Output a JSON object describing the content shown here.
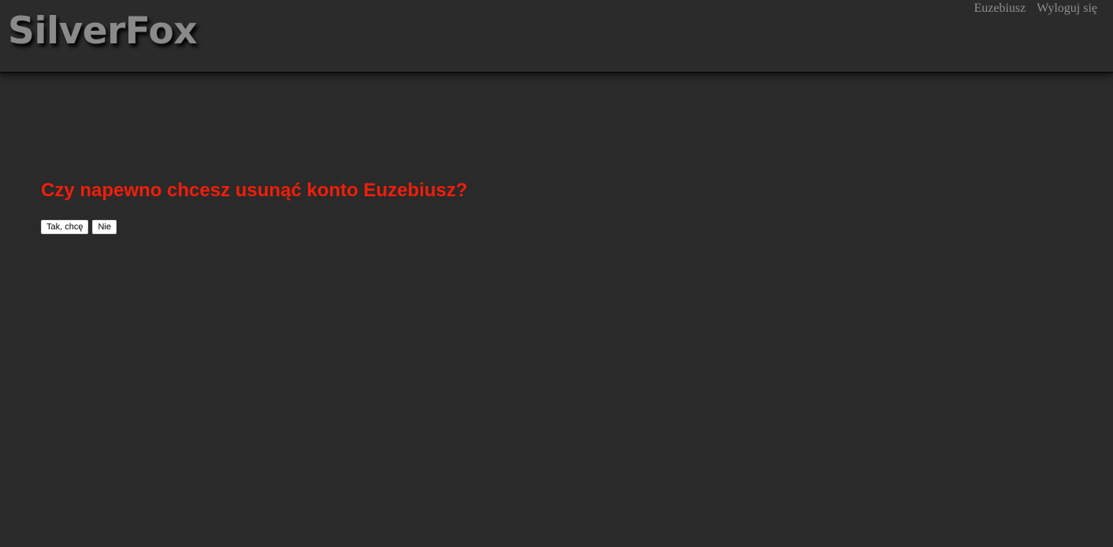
{
  "header": {
    "logo": "SilverFox",
    "user_name": "Euzebiusz",
    "logout_label": "Wyloguj się"
  },
  "main": {
    "confirm_question": "Czy napewno chcesz usunąć konto Euzebiusz?",
    "yes_label": "Tak, chcę",
    "no_label": "Nie"
  },
  "colors": {
    "background": "#2a2a2a",
    "header_background": "#2b2b2b",
    "logo_text": "#8a8a8a",
    "nav_text": "#8f8f8f",
    "question_text": "#f01e0a",
    "button_background": "#ffffff"
  }
}
